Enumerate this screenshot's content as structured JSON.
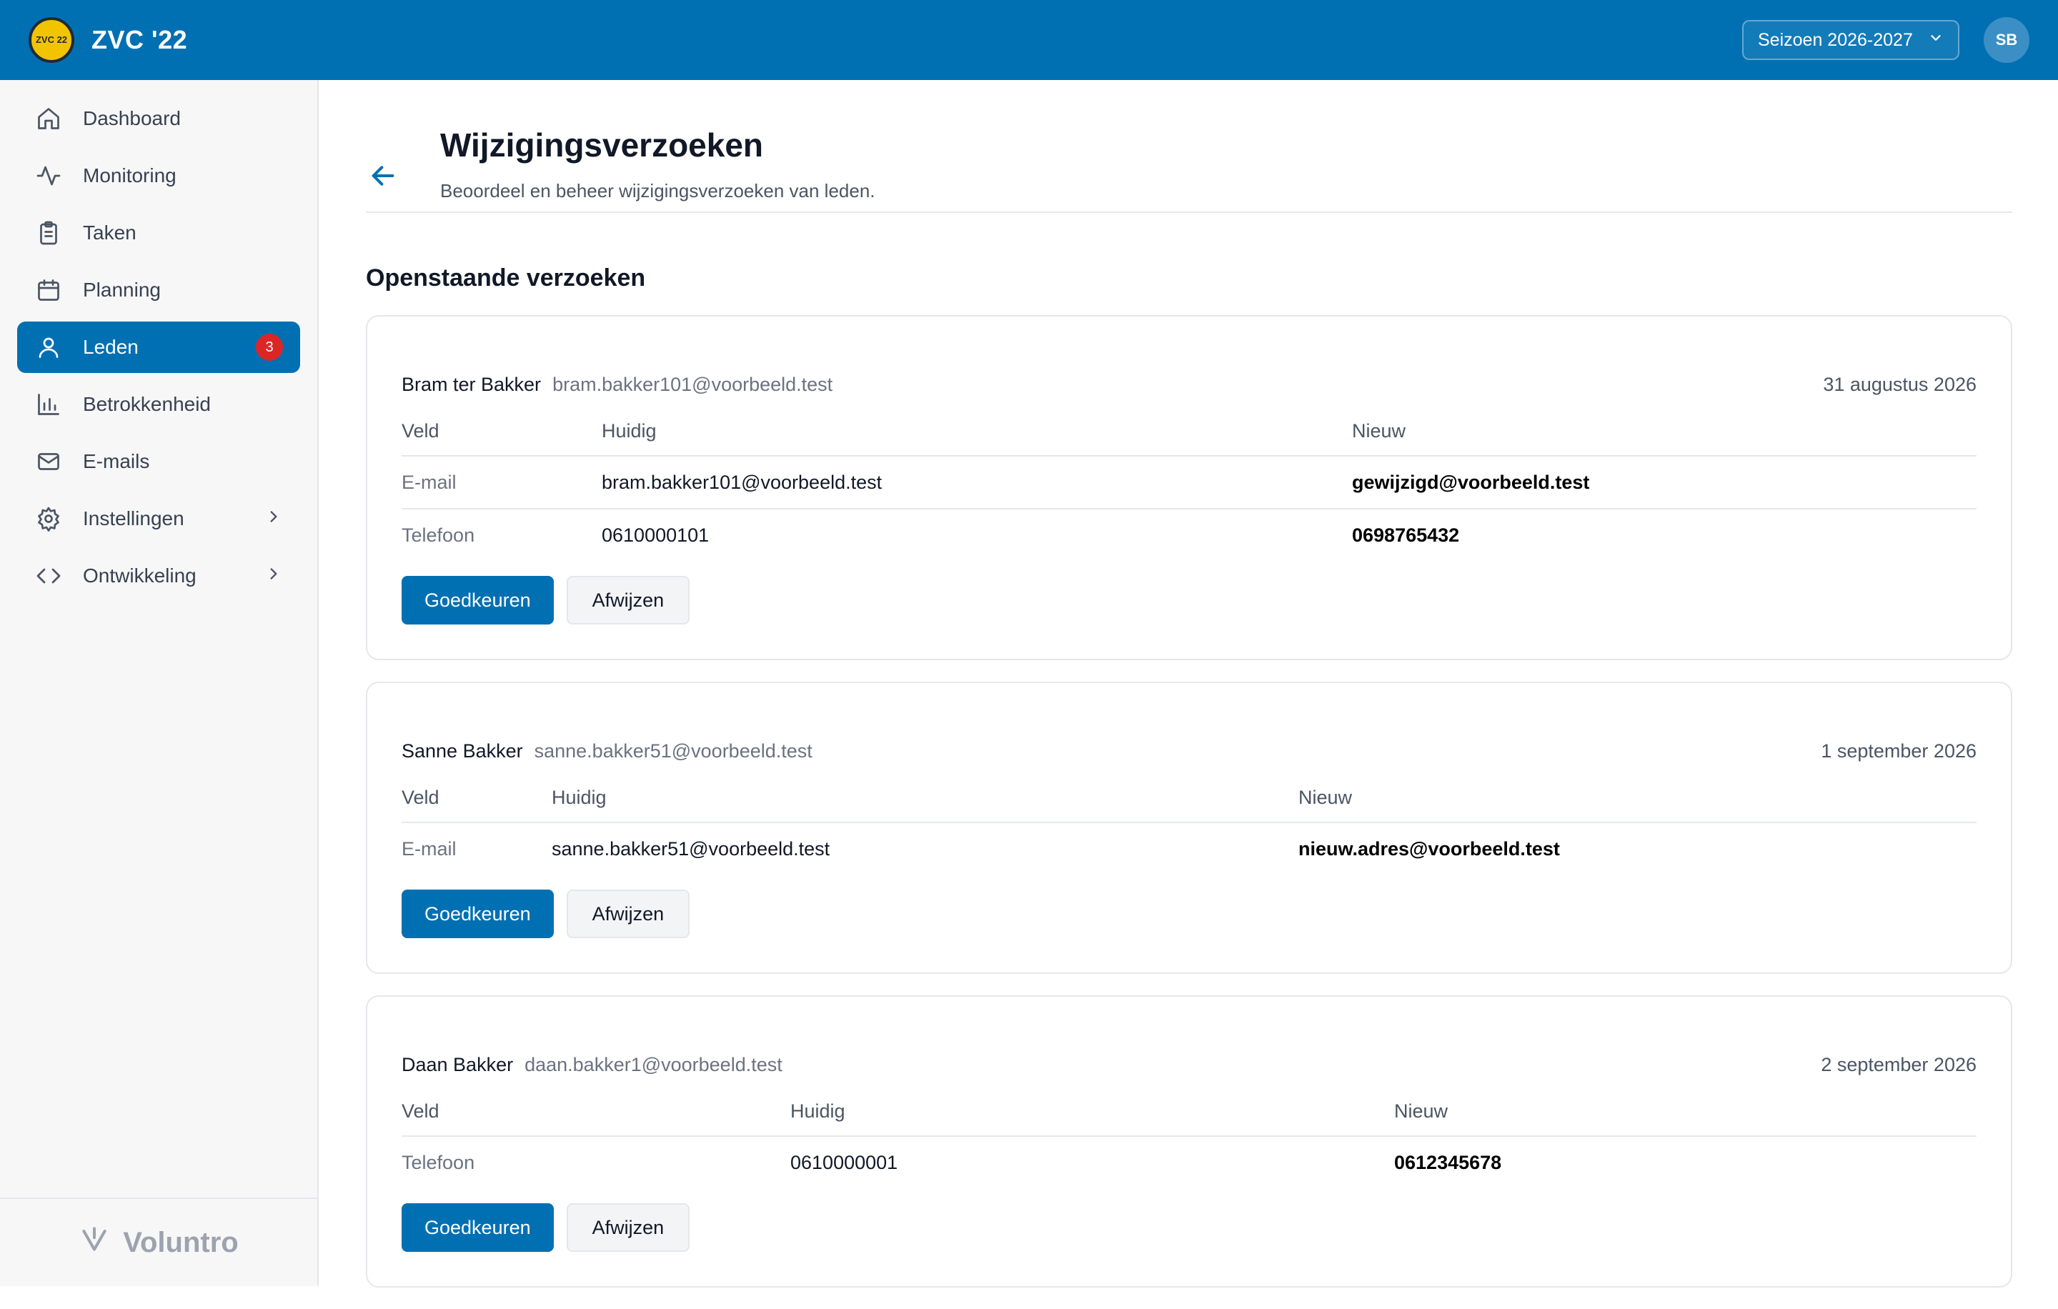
{
  "app": {
    "title": "ZVC '22",
    "logo_text": "ZVC 22",
    "season": "Seizoen 2026-2027",
    "avatar_initials": "SB"
  },
  "sidebar": {
    "items": [
      {
        "label": "Dashboard",
        "icon": "home-icon"
      },
      {
        "label": "Monitoring",
        "icon": "activity-icon"
      },
      {
        "label": "Taken",
        "icon": "clipboard-icon"
      },
      {
        "label": "Planning",
        "icon": "calendar-icon"
      },
      {
        "label": "Leden",
        "icon": "user-icon",
        "active": true,
        "badge": "3"
      },
      {
        "label": "Betrokkenheid",
        "icon": "bar-chart-icon"
      },
      {
        "label": "E-mails",
        "icon": "mail-icon"
      },
      {
        "label": "Instellingen",
        "icon": "gear-icon",
        "has_submenu": true
      },
      {
        "label": "Ontwikkeling",
        "icon": "code-icon",
        "has_submenu": true
      }
    ],
    "footer_brand": "Voluntro"
  },
  "page": {
    "title": "Wijzigingsverzoeken",
    "subtitle": "Beoordeel en beheer wijzigingsverzoeken van leden.",
    "section_title": "Openstaande verzoeken"
  },
  "table_headers": {
    "field": "Veld",
    "current": "Huidig",
    "new": "Nieuw"
  },
  "buttons": {
    "approve": "Goedkeuren",
    "reject": "Afwijzen"
  },
  "requests": [
    {
      "name": "Bram ter Bakker",
      "email": "bram.bakker101@voorbeeld.test",
      "date": "31 augustus 2026",
      "rows": [
        {
          "field": "E-mail",
          "current": "bram.bakker101@voorbeeld.test",
          "new": "gewijzigd@voorbeeld.test"
        },
        {
          "field": "Telefoon",
          "current": "0610000101",
          "new": "0698765432"
        }
      ]
    },
    {
      "name": "Sanne Bakker",
      "email": "sanne.bakker51@voorbeeld.test",
      "date": "1 september 2026",
      "rows": [
        {
          "field": "E-mail",
          "current": "sanne.bakker51@voorbeeld.test",
          "new": "nieuw.adres@voorbeeld.test"
        }
      ]
    },
    {
      "name": "Daan Bakker",
      "email": "daan.bakker1@voorbeeld.test",
      "date": "2 september 2026",
      "rows": [
        {
          "field": "Telefoon",
          "current": "0610000001",
          "new": "0612345678"
        }
      ]
    }
  ],
  "colors": {
    "brand": "#0070b3",
    "badge": "#dc2626",
    "logo": "#f2c400"
  }
}
